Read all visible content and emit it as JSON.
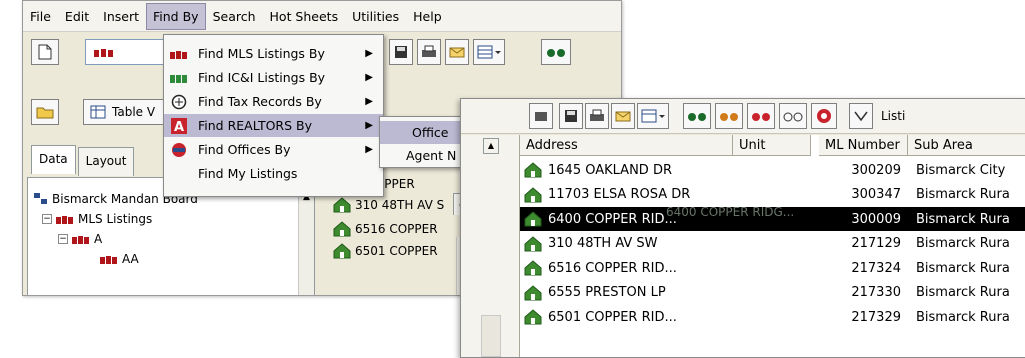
{
  "menubar": [
    "File",
    "Edit",
    "Insert",
    "Find By",
    "Search",
    "Hot Sheets",
    "Utilities",
    "Help"
  ],
  "toolbar": {
    "table_button": "Table V"
  },
  "tabs": [
    "Data",
    "Layout"
  ],
  "tree": {
    "root": "Bismarck Mandan Board",
    "mls": "MLS Listings",
    "a": "A",
    "aa": "AA"
  },
  "find_menu": [
    {
      "label": "Find MLS Listings By",
      "submenu": true,
      "icon": "mls-listings-icon"
    },
    {
      "label": "Find IC&I Listings By",
      "submenu": true,
      "icon": "ici-listings-icon"
    },
    {
      "label": "Find Tax Records By",
      "submenu": true,
      "icon": "tax-records-icon"
    },
    {
      "label": "Find REALTORS By",
      "submenu": true,
      "icon": "realtors-icon"
    },
    {
      "label": "Find Offices By",
      "submenu": true,
      "icon": "offices-icon"
    },
    {
      "label": "Find My Listings",
      "submenu": false,
      "icon": ""
    }
  ],
  "realtors_submenu": [
    "Office",
    "Agent N"
  ],
  "middle_list": {
    "header_fragment": "s",
    "rows": [
      "0 COPPER",
      "310 48TH AV S",
      "6516 COPPER",
      "6501 COPPER"
    ],
    "tab_fragment": "es"
  },
  "listing_table": {
    "toolbar_fragment": "Listi",
    "columns": [
      "Address",
      "Unit",
      "ML Number",
      "Sub Area"
    ],
    "rows": [
      {
        "address": "1645 OAKLAND DR",
        "unit": "",
        "ml": "300209",
        "sub": "Bismarck City",
        "selected": false
      },
      {
        "address": "11703 ELSA ROSA DR",
        "unit": "",
        "ml": "300347",
        "sub": "Bismarck Rura",
        "selected": false
      },
      {
        "address": "6400 COPPER RID...",
        "unit": "",
        "ml": "300009",
        "sub": "Bismarck Rura",
        "selected": true
      },
      {
        "address": "310 48TH AV SW",
        "unit": "",
        "ml": "217129",
        "sub": "Bismarck Rura",
        "selected": false
      },
      {
        "address": "6516 COPPER RID...",
        "unit": "",
        "ml": "217324",
        "sub": "Bismarck Rura",
        "selected": false
      },
      {
        "address": "6555 PRESTON LP",
        "unit": "",
        "ml": "217330",
        "sub": "Bismarck Rura",
        "selected": false
      },
      {
        "address": "6501 COPPER RID...",
        "unit": "",
        "ml": "217329",
        "sub": "Bismarck Rura",
        "selected": false
      }
    ],
    "drag_ghost": "6400 COPPER RIDG..."
  },
  "colors": {
    "menu_highlight": "#bcb9d3",
    "house_green": "#3d8a2f",
    "window_bg": "#ece9d8"
  }
}
